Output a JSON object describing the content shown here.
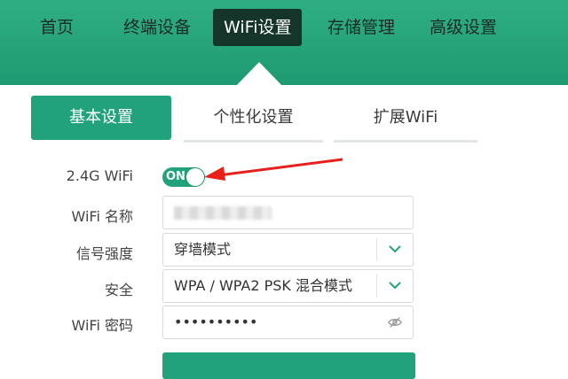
{
  "nav": {
    "items": [
      {
        "label": "首页"
      },
      {
        "label": "终端设备"
      },
      {
        "label": "WiFi设置",
        "active": true
      },
      {
        "label": "存储管理"
      },
      {
        "label": "高级设置"
      }
    ]
  },
  "tabs": [
    {
      "label": "基本设置",
      "active": true
    },
    {
      "label": "个性化设置"
    },
    {
      "label": "扩展WiFi"
    }
  ],
  "form": {
    "wifi24": {
      "label": "2.4G WiFi",
      "toggle_text": "ON",
      "enabled": true
    },
    "ssid": {
      "label": "WiFi 名称"
    },
    "signal": {
      "label": "信号强度",
      "value": "穿墙模式"
    },
    "security": {
      "label": "安全",
      "value": "WPA / WPA2 PSK 混合模式"
    },
    "password": {
      "label": "WiFi 密码",
      "value": "••••••••••"
    }
  },
  "colors": {
    "accent": "#22a27a",
    "nav_active_bg": "#15352b",
    "annotation_arrow": "#e8201c"
  },
  "icons": {
    "dropdown": "chevron-down-icon",
    "password_visibility": "eye-off-icon"
  }
}
